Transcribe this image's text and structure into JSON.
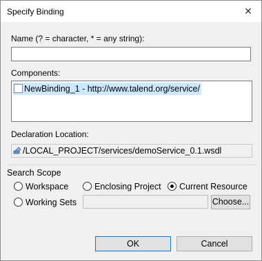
{
  "window": {
    "title": "Specify Binding",
    "close_glyph": "✕"
  },
  "name": {
    "label": "Name (? = character, * = any string):",
    "value": ""
  },
  "components": {
    "label": "Components:",
    "items": [
      {
        "label": "NewBinding_1 - http://www.talend.org/service/",
        "selected": true
      }
    ]
  },
  "declaration": {
    "label": "Declaration Location:",
    "icon": "wsdl-file-icon",
    "value": "/LOCAL_PROJECT/services/demoService_0.1.wsdl"
  },
  "search_scope": {
    "title": "Search Scope",
    "options": [
      {
        "label": "Workspace",
        "checked": false
      },
      {
        "label": "Enclosing Project",
        "checked": false
      },
      {
        "label": "Current Resource",
        "checked": true
      },
      {
        "label": "Working Sets",
        "checked": false
      }
    ],
    "working_sets_value": "",
    "choose_label": "Choose..."
  },
  "buttons": {
    "ok": "OK",
    "cancel": "Cancel"
  }
}
